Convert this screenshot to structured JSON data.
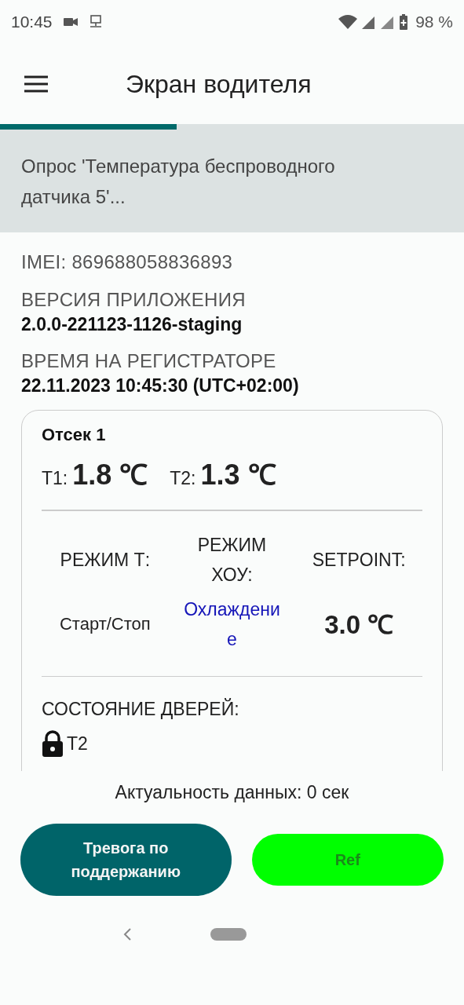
{
  "status_bar": {
    "time": "10:45",
    "battery": "98 %"
  },
  "app_bar": {
    "title": "Экран водителя"
  },
  "progress": {
    "level": 0.38
  },
  "banner": {
    "text": "Опрос 'Температура беспроводного датчика 5'..."
  },
  "info": [
    {
      "label": "IMEI: 869688058836893"
    },
    {
      "label": "ВЕРСИЯ ПРИЛОЖЕНИЯ",
      "value": "2.0.0-221123-1126-staging"
    },
    {
      "label": "ВРЕМЯ НА РЕГИСТРАТОРЕ",
      "value": "22.11.2023 10:45:30 (UTC+02:00)"
    }
  ],
  "compartment": {
    "title": "Отсек 1",
    "temps": [
      {
        "label": "T1:",
        "value": "1.8 ℃"
      },
      {
        "label": "T2:",
        "value": "1.3 ℃"
      }
    ],
    "modes": [
      {
        "label": "РЕЖИМ Т:",
        "value": "Старт/Стоп",
        "kind": "plain"
      },
      {
        "label": "РЕЖИМ ХОУ:",
        "value": "Охлаждение",
        "kind": "link"
      },
      {
        "label": "SETPOINT:",
        "value": "3.0 ℃",
        "kind": "big"
      }
    ],
    "doors_label": "СОСТОЯНИЕ ДВЕРЕЙ:",
    "doors": [
      {
        "name": "T2",
        "locked": true
      }
    ]
  },
  "freshness": "Актуальность данных: 0 сек",
  "buttons": [
    {
      "label": "Тревога по поддержанию",
      "kind": "primary"
    },
    {
      "label": "Ref",
      "kind": "green"
    }
  ]
}
